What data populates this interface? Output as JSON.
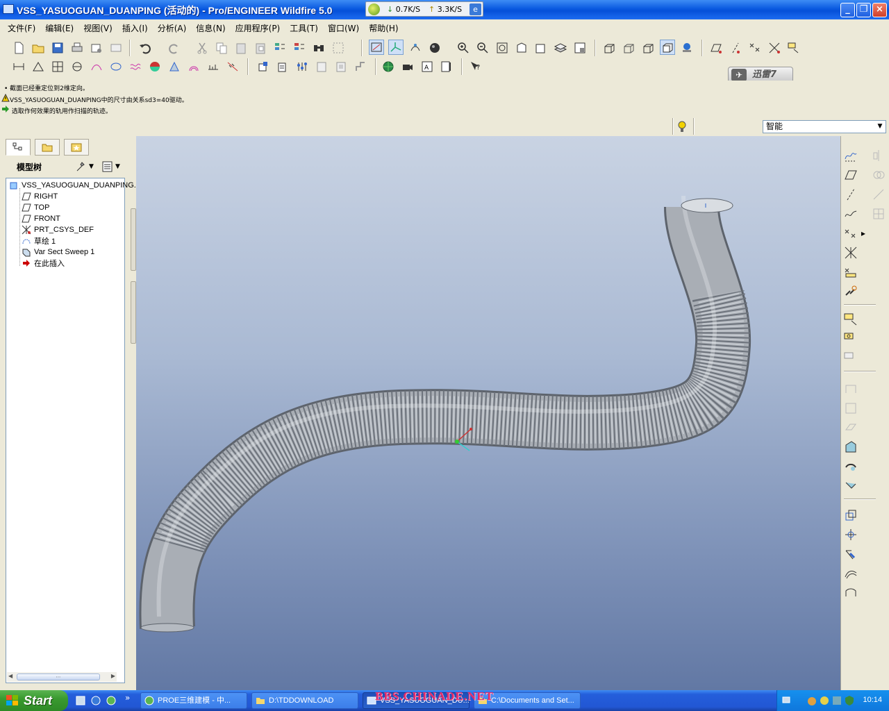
{
  "window": {
    "title": "VSS_YASUOGUAN_DUANPING (活动的) - Pro/ENGINEER Wildfire 5.0",
    "download_speed": "0.7K/S",
    "upload_speed": "3.3K/S"
  },
  "menu": [
    "文件(F)",
    "编辑(E)",
    "视图(V)",
    "插入(I)",
    "分析(A)",
    "信息(N)",
    "应用程序(P)",
    "工具(T)",
    "窗口(W)",
    "帮助(H)"
  ],
  "xunlei": "迅雷7",
  "messages": [
    {
      "icon": "bullet",
      "text": "• 截面已经重定位到2维定向。"
    },
    {
      "icon": "warning",
      "text": "VSS_YASUOGUAN_DUANPING中的尺寸由关系sd3=40驱动。"
    },
    {
      "icon": "arrow",
      "text": "选取作何效果的轨用作扫描的轨迹。"
    }
  ],
  "filter": {
    "selected": "智能"
  },
  "model_tree": {
    "title": "模型树",
    "items": [
      {
        "label": "VSS_YASUOGUAN_DUANPING.",
        "icon": "part-icon"
      },
      {
        "label": "RIGHT",
        "icon": "datum-plane-icon"
      },
      {
        "label": "TOP",
        "icon": "datum-plane-icon"
      },
      {
        "label": "FRONT",
        "icon": "datum-plane-icon"
      },
      {
        "label": "PRT_CSYS_DEF",
        "icon": "csys-icon"
      },
      {
        "label": "草绘 1",
        "icon": "sketch-icon"
      },
      {
        "label": "Var Sect Sweep 1",
        "icon": "sweep-icon"
      },
      {
        "label": "在此插入",
        "icon": "insert-arrow-icon"
      }
    ]
  },
  "taskbar": {
    "start": "Start",
    "tasks": [
      {
        "label": "PROE三维建模 - 中...",
        "active": false
      },
      {
        "label": "D:\\TDDOWNLOAD",
        "active": false
      },
      {
        "label": "VSS_YASUOGUAN_DU...",
        "active": true
      },
      {
        "label": "C:\\Documents and Set...",
        "active": false
      }
    ],
    "clock": "10:14"
  },
  "watermark": "BBS.CHINADE.NET",
  "colors": {
    "viewport_top": "#c9d3e3",
    "viewport_bottom": "#6278a4",
    "model_surface": "#a7acb3",
    "titlebar": "#0a5ae0",
    "taskbar": "#245edb"
  }
}
